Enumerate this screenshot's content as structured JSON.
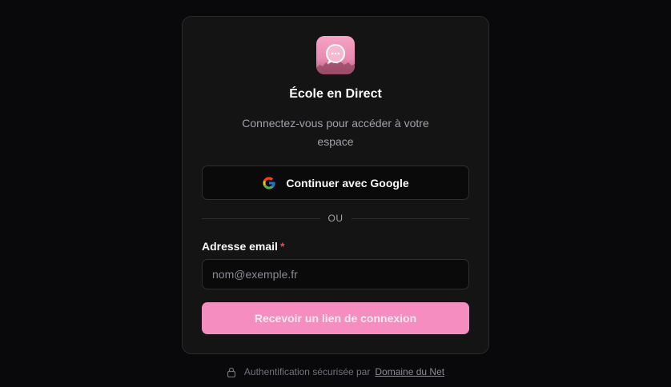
{
  "app": {
    "title": "École en Direct",
    "subtitle": "Connectez-vous pour accéder à votre espace"
  },
  "google_button": {
    "label": "Continuer avec Google"
  },
  "divider": {
    "text": "OU"
  },
  "email": {
    "label": "Adresse email",
    "required_marker": "*",
    "value": "",
    "placeholder": "nom@exemple.fr"
  },
  "submit_button": {
    "label": "Recevoir un lien de connexion"
  },
  "footer": {
    "text": "Authentification sécurisée par",
    "link": "Domaine du Net"
  },
  "colors": {
    "background": "#09090b",
    "card": "#141414",
    "accent": "#f58dc0",
    "required": "#f43f5e"
  },
  "icons": {
    "logo": "chat-bubble-logo-icon",
    "google": "google-icon",
    "lock": "lock-icon"
  }
}
